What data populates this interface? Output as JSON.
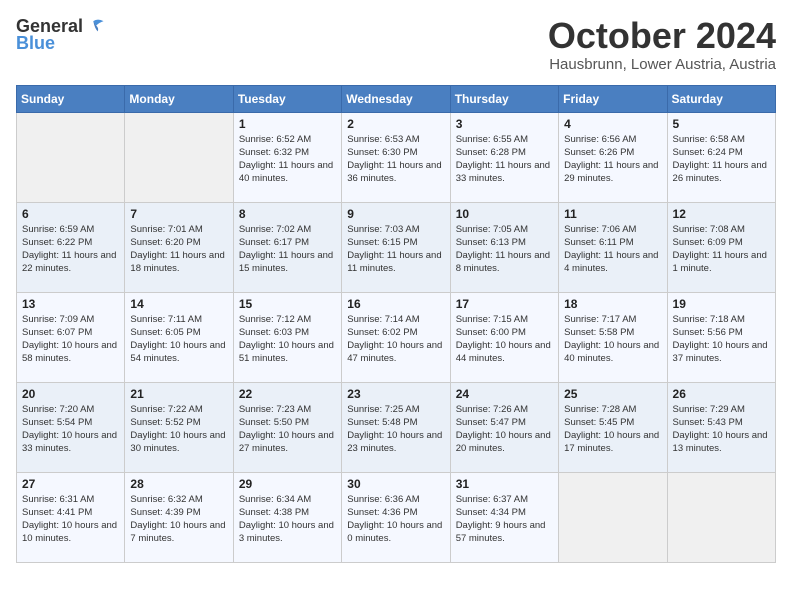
{
  "header": {
    "logo_general": "General",
    "logo_blue": "Blue",
    "month": "October 2024",
    "location": "Hausbrunn, Lower Austria, Austria"
  },
  "days_of_week": [
    "Sunday",
    "Monday",
    "Tuesday",
    "Wednesday",
    "Thursday",
    "Friday",
    "Saturday"
  ],
  "weeks": [
    [
      {
        "day": "",
        "info": ""
      },
      {
        "day": "",
        "info": ""
      },
      {
        "day": "1",
        "info": "Sunrise: 6:52 AM\nSunset: 6:32 PM\nDaylight: 11 hours and 40 minutes."
      },
      {
        "day": "2",
        "info": "Sunrise: 6:53 AM\nSunset: 6:30 PM\nDaylight: 11 hours and 36 minutes."
      },
      {
        "day": "3",
        "info": "Sunrise: 6:55 AM\nSunset: 6:28 PM\nDaylight: 11 hours and 33 minutes."
      },
      {
        "day": "4",
        "info": "Sunrise: 6:56 AM\nSunset: 6:26 PM\nDaylight: 11 hours and 29 minutes."
      },
      {
        "day": "5",
        "info": "Sunrise: 6:58 AM\nSunset: 6:24 PM\nDaylight: 11 hours and 26 minutes."
      }
    ],
    [
      {
        "day": "6",
        "info": "Sunrise: 6:59 AM\nSunset: 6:22 PM\nDaylight: 11 hours and 22 minutes."
      },
      {
        "day": "7",
        "info": "Sunrise: 7:01 AM\nSunset: 6:20 PM\nDaylight: 11 hours and 18 minutes."
      },
      {
        "day": "8",
        "info": "Sunrise: 7:02 AM\nSunset: 6:17 PM\nDaylight: 11 hours and 15 minutes."
      },
      {
        "day": "9",
        "info": "Sunrise: 7:03 AM\nSunset: 6:15 PM\nDaylight: 11 hours and 11 minutes."
      },
      {
        "day": "10",
        "info": "Sunrise: 7:05 AM\nSunset: 6:13 PM\nDaylight: 11 hours and 8 minutes."
      },
      {
        "day": "11",
        "info": "Sunrise: 7:06 AM\nSunset: 6:11 PM\nDaylight: 11 hours and 4 minutes."
      },
      {
        "day": "12",
        "info": "Sunrise: 7:08 AM\nSunset: 6:09 PM\nDaylight: 11 hours and 1 minute."
      }
    ],
    [
      {
        "day": "13",
        "info": "Sunrise: 7:09 AM\nSunset: 6:07 PM\nDaylight: 10 hours and 58 minutes."
      },
      {
        "day": "14",
        "info": "Sunrise: 7:11 AM\nSunset: 6:05 PM\nDaylight: 10 hours and 54 minutes."
      },
      {
        "day": "15",
        "info": "Sunrise: 7:12 AM\nSunset: 6:03 PM\nDaylight: 10 hours and 51 minutes."
      },
      {
        "day": "16",
        "info": "Sunrise: 7:14 AM\nSunset: 6:02 PM\nDaylight: 10 hours and 47 minutes."
      },
      {
        "day": "17",
        "info": "Sunrise: 7:15 AM\nSunset: 6:00 PM\nDaylight: 10 hours and 44 minutes."
      },
      {
        "day": "18",
        "info": "Sunrise: 7:17 AM\nSunset: 5:58 PM\nDaylight: 10 hours and 40 minutes."
      },
      {
        "day": "19",
        "info": "Sunrise: 7:18 AM\nSunset: 5:56 PM\nDaylight: 10 hours and 37 minutes."
      }
    ],
    [
      {
        "day": "20",
        "info": "Sunrise: 7:20 AM\nSunset: 5:54 PM\nDaylight: 10 hours and 33 minutes."
      },
      {
        "day": "21",
        "info": "Sunrise: 7:22 AM\nSunset: 5:52 PM\nDaylight: 10 hours and 30 minutes."
      },
      {
        "day": "22",
        "info": "Sunrise: 7:23 AM\nSunset: 5:50 PM\nDaylight: 10 hours and 27 minutes."
      },
      {
        "day": "23",
        "info": "Sunrise: 7:25 AM\nSunset: 5:48 PM\nDaylight: 10 hours and 23 minutes."
      },
      {
        "day": "24",
        "info": "Sunrise: 7:26 AM\nSunset: 5:47 PM\nDaylight: 10 hours and 20 minutes."
      },
      {
        "day": "25",
        "info": "Sunrise: 7:28 AM\nSunset: 5:45 PM\nDaylight: 10 hours and 17 minutes."
      },
      {
        "day": "26",
        "info": "Sunrise: 7:29 AM\nSunset: 5:43 PM\nDaylight: 10 hours and 13 minutes."
      }
    ],
    [
      {
        "day": "27",
        "info": "Sunrise: 6:31 AM\nSunset: 4:41 PM\nDaylight: 10 hours and 10 minutes."
      },
      {
        "day": "28",
        "info": "Sunrise: 6:32 AM\nSunset: 4:39 PM\nDaylight: 10 hours and 7 minutes."
      },
      {
        "day": "29",
        "info": "Sunrise: 6:34 AM\nSunset: 4:38 PM\nDaylight: 10 hours and 3 minutes."
      },
      {
        "day": "30",
        "info": "Sunrise: 6:36 AM\nSunset: 4:36 PM\nDaylight: 10 hours and 0 minutes."
      },
      {
        "day": "31",
        "info": "Sunrise: 6:37 AM\nSunset: 4:34 PM\nDaylight: 9 hours and 57 minutes."
      },
      {
        "day": "",
        "info": ""
      },
      {
        "day": "",
        "info": ""
      }
    ]
  ]
}
